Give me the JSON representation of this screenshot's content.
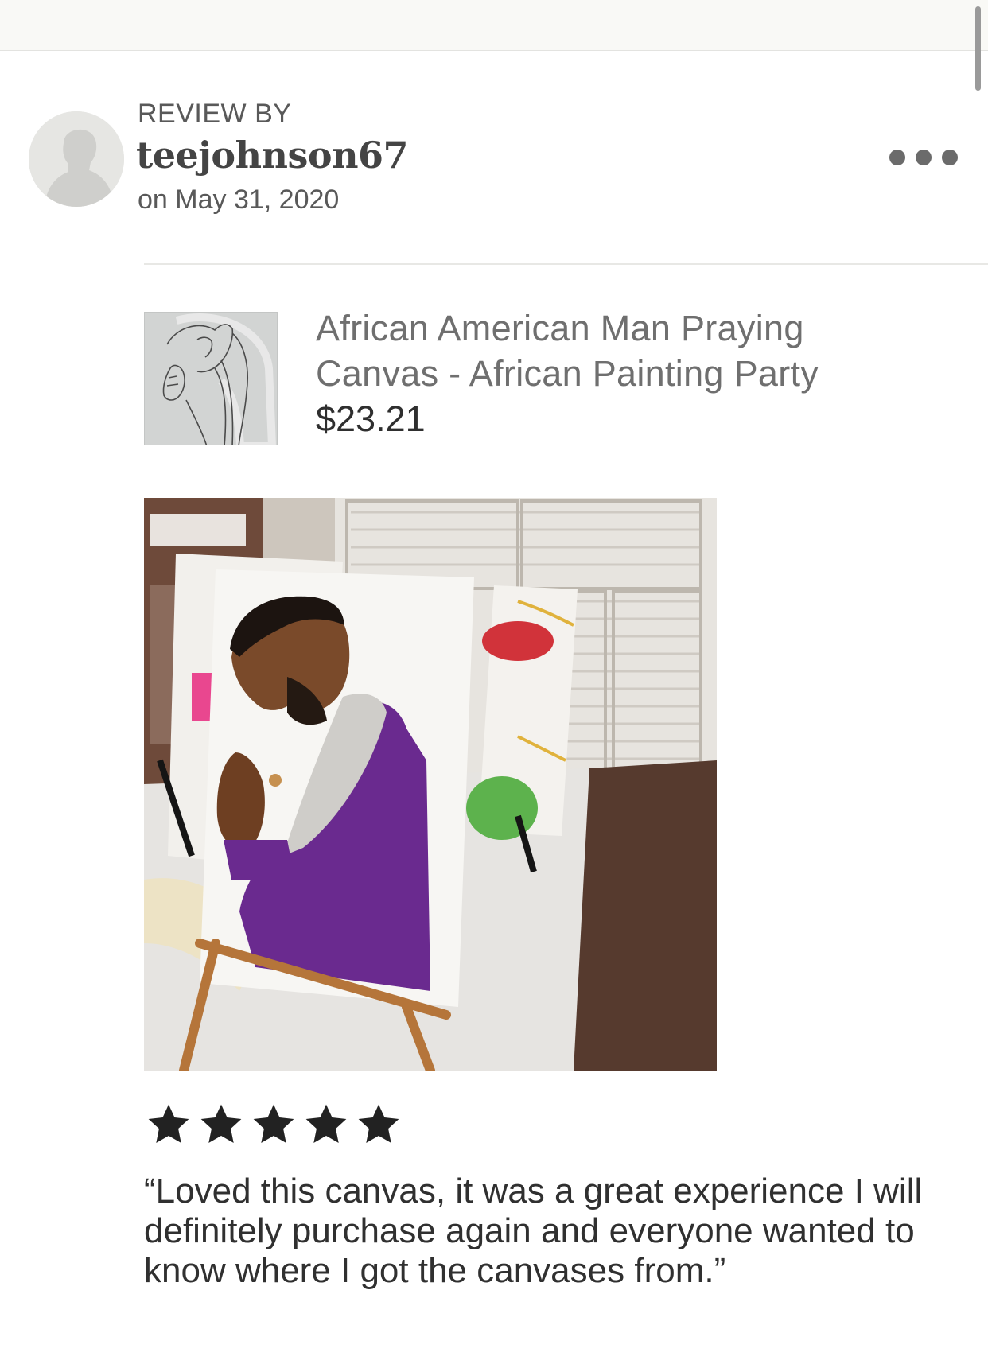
{
  "review": {
    "label": "REVIEW BY",
    "username": "teejohnson67",
    "date": "on May 31, 2020",
    "rating": 5,
    "rating_max": 5,
    "text": "“Loved this canvas, it was a great experience I will definitely purchase again and everyone wanted to know where I got the canvases from.”"
  },
  "product": {
    "title": "African American Man Praying Canvas - African Painting Party",
    "price": "$23.21"
  },
  "icons": {
    "avatar": "default-user-silhouette-icon",
    "more": "more-options-dots-icon",
    "star": "filled-star-icon"
  },
  "colors": {
    "star": "#222222",
    "muted_text": "#595959",
    "top_bar": "#f9f9f6"
  }
}
